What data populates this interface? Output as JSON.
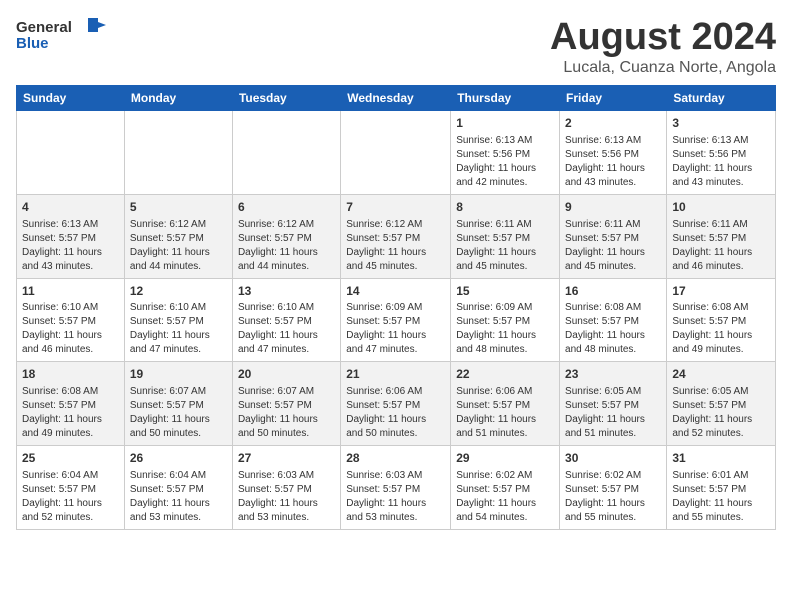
{
  "logo": {
    "general": "General",
    "blue": "Blue"
  },
  "title": "August 2024",
  "subtitle": "Lucala, Cuanza Norte, Angola",
  "days_of_week": [
    "Sunday",
    "Monday",
    "Tuesday",
    "Wednesday",
    "Thursday",
    "Friday",
    "Saturday"
  ],
  "weeks": [
    [
      {
        "day": "",
        "info": ""
      },
      {
        "day": "",
        "info": ""
      },
      {
        "day": "",
        "info": ""
      },
      {
        "day": "",
        "info": ""
      },
      {
        "day": "1",
        "info": "Sunrise: 6:13 AM\nSunset: 5:56 PM\nDaylight: 11 hours and 42 minutes."
      },
      {
        "day": "2",
        "info": "Sunrise: 6:13 AM\nSunset: 5:56 PM\nDaylight: 11 hours and 43 minutes."
      },
      {
        "day": "3",
        "info": "Sunrise: 6:13 AM\nSunset: 5:56 PM\nDaylight: 11 hours and 43 minutes."
      }
    ],
    [
      {
        "day": "4",
        "info": "Sunrise: 6:13 AM\nSunset: 5:57 PM\nDaylight: 11 hours and 43 minutes."
      },
      {
        "day": "5",
        "info": "Sunrise: 6:12 AM\nSunset: 5:57 PM\nDaylight: 11 hours and 44 minutes."
      },
      {
        "day": "6",
        "info": "Sunrise: 6:12 AM\nSunset: 5:57 PM\nDaylight: 11 hours and 44 minutes."
      },
      {
        "day": "7",
        "info": "Sunrise: 6:12 AM\nSunset: 5:57 PM\nDaylight: 11 hours and 45 minutes."
      },
      {
        "day": "8",
        "info": "Sunrise: 6:11 AM\nSunset: 5:57 PM\nDaylight: 11 hours and 45 minutes."
      },
      {
        "day": "9",
        "info": "Sunrise: 6:11 AM\nSunset: 5:57 PM\nDaylight: 11 hours and 45 minutes."
      },
      {
        "day": "10",
        "info": "Sunrise: 6:11 AM\nSunset: 5:57 PM\nDaylight: 11 hours and 46 minutes."
      }
    ],
    [
      {
        "day": "11",
        "info": "Sunrise: 6:10 AM\nSunset: 5:57 PM\nDaylight: 11 hours and 46 minutes."
      },
      {
        "day": "12",
        "info": "Sunrise: 6:10 AM\nSunset: 5:57 PM\nDaylight: 11 hours and 47 minutes."
      },
      {
        "day": "13",
        "info": "Sunrise: 6:10 AM\nSunset: 5:57 PM\nDaylight: 11 hours and 47 minutes."
      },
      {
        "day": "14",
        "info": "Sunrise: 6:09 AM\nSunset: 5:57 PM\nDaylight: 11 hours and 47 minutes."
      },
      {
        "day": "15",
        "info": "Sunrise: 6:09 AM\nSunset: 5:57 PM\nDaylight: 11 hours and 48 minutes."
      },
      {
        "day": "16",
        "info": "Sunrise: 6:08 AM\nSunset: 5:57 PM\nDaylight: 11 hours and 48 minutes."
      },
      {
        "day": "17",
        "info": "Sunrise: 6:08 AM\nSunset: 5:57 PM\nDaylight: 11 hours and 49 minutes."
      }
    ],
    [
      {
        "day": "18",
        "info": "Sunrise: 6:08 AM\nSunset: 5:57 PM\nDaylight: 11 hours and 49 minutes."
      },
      {
        "day": "19",
        "info": "Sunrise: 6:07 AM\nSunset: 5:57 PM\nDaylight: 11 hours and 50 minutes."
      },
      {
        "day": "20",
        "info": "Sunrise: 6:07 AM\nSunset: 5:57 PM\nDaylight: 11 hours and 50 minutes."
      },
      {
        "day": "21",
        "info": "Sunrise: 6:06 AM\nSunset: 5:57 PM\nDaylight: 11 hours and 50 minutes."
      },
      {
        "day": "22",
        "info": "Sunrise: 6:06 AM\nSunset: 5:57 PM\nDaylight: 11 hours and 51 minutes."
      },
      {
        "day": "23",
        "info": "Sunrise: 6:05 AM\nSunset: 5:57 PM\nDaylight: 11 hours and 51 minutes."
      },
      {
        "day": "24",
        "info": "Sunrise: 6:05 AM\nSunset: 5:57 PM\nDaylight: 11 hours and 52 minutes."
      }
    ],
    [
      {
        "day": "25",
        "info": "Sunrise: 6:04 AM\nSunset: 5:57 PM\nDaylight: 11 hours and 52 minutes."
      },
      {
        "day": "26",
        "info": "Sunrise: 6:04 AM\nSunset: 5:57 PM\nDaylight: 11 hours and 53 minutes."
      },
      {
        "day": "27",
        "info": "Sunrise: 6:03 AM\nSunset: 5:57 PM\nDaylight: 11 hours and 53 minutes."
      },
      {
        "day": "28",
        "info": "Sunrise: 6:03 AM\nSunset: 5:57 PM\nDaylight: 11 hours and 53 minutes."
      },
      {
        "day": "29",
        "info": "Sunrise: 6:02 AM\nSunset: 5:57 PM\nDaylight: 11 hours and 54 minutes."
      },
      {
        "day": "30",
        "info": "Sunrise: 6:02 AM\nSunset: 5:57 PM\nDaylight: 11 hours and 55 minutes."
      },
      {
        "day": "31",
        "info": "Sunrise: 6:01 AM\nSunset: 5:57 PM\nDaylight: 11 hours and 55 minutes."
      }
    ]
  ]
}
